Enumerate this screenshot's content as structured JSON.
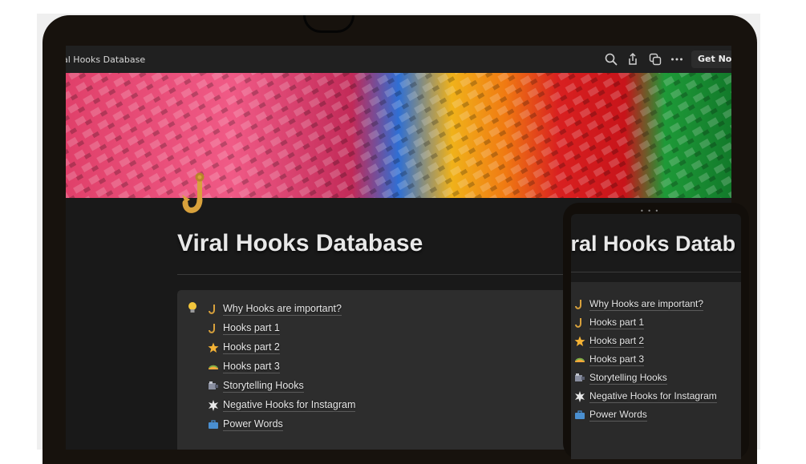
{
  "window": {
    "breadcrumb": "al Hooks Database"
  },
  "toolbar": {
    "search_icon": "search-icon",
    "share_icon": "share-icon",
    "duplicate_icon": "duplicate-icon",
    "more_icon": "more-icon",
    "get_notion_label": "Get Notio"
  },
  "page": {
    "title": "Viral Hooks Database",
    "icon": "hook-icon"
  },
  "toc": {
    "items": [
      {
        "label": "Why Hooks are important?",
        "icon": "hook-icon"
      },
      {
        "label": "Hooks part 1",
        "icon": "hook-icon"
      },
      {
        "label": "Hooks part 2",
        "icon": "star-icon"
      },
      {
        "label": "Hooks part 3",
        "icon": "taco-icon"
      },
      {
        "label": "Storytelling Hooks",
        "icon": "film-icon"
      },
      {
        "label": "Negative Hooks for Instagram",
        "icon": "burst-icon"
      },
      {
        "label": "Power Words",
        "icon": "briefcase-icon"
      }
    ]
  },
  "phone": {
    "title": "iral Hooks Datab",
    "dots": "• • •"
  },
  "colors": {
    "background": "#191919",
    "toc_background": "#2d2d2d",
    "text": "#e6e6e6",
    "hook_gold": "#d8a13c"
  }
}
